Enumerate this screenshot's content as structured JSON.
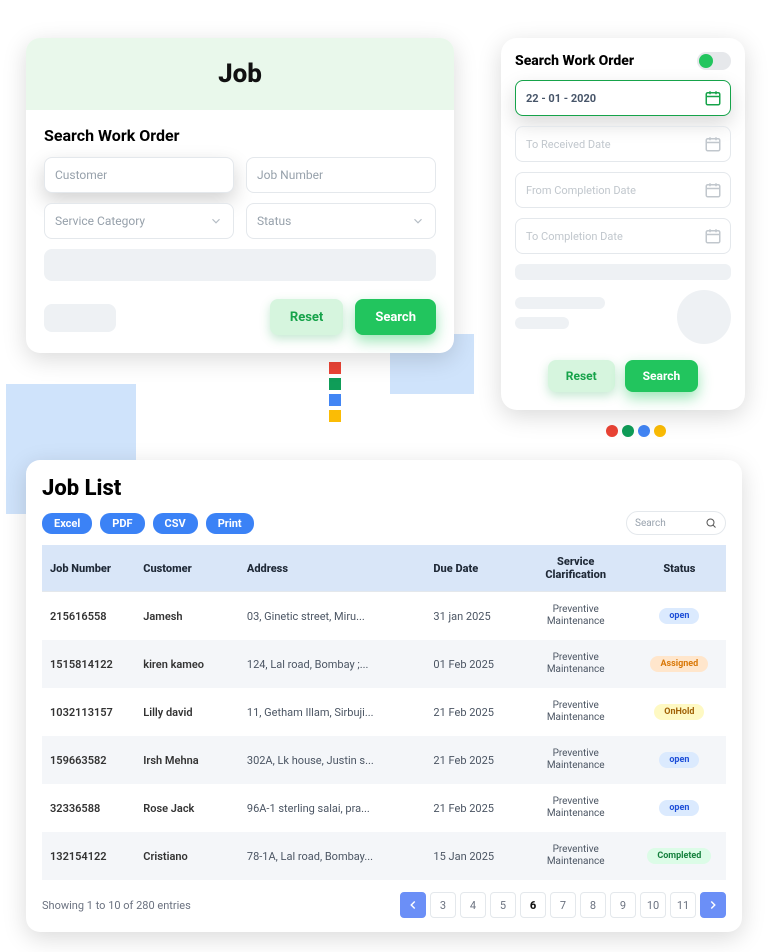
{
  "job_card": {
    "title": "Job",
    "subtitle": "Search Work Order",
    "fields": {
      "customer": "Customer",
      "job_number": "Job Number",
      "service_category": "Service Category",
      "status": "Status"
    },
    "reset": "Reset",
    "search": "Search"
  },
  "swo_card": {
    "title": "Search Work Order",
    "date_value": "22 - 01 - 2020",
    "f1": "To Received Date",
    "f2": "From Completion Date",
    "f3": "To Completion Date",
    "reset": "Reset",
    "search": "Search"
  },
  "job_list": {
    "title": "Job List",
    "exports": [
      "Excel",
      "PDF",
      "CSV",
      "Print"
    ],
    "search_placeholder": "Search",
    "columns": [
      "Job Number",
      "Customer",
      "Address",
      "Due Date",
      "Service Clarification",
      "Status"
    ],
    "rows": [
      {
        "job": "215616558",
        "customer": "Jamesh",
        "address": "03, Ginetic street, Miru...",
        "due": "31 jan 2025",
        "service": "Preventive Maintenance",
        "status": "open",
        "cls": "b-open"
      },
      {
        "job": "1515814122",
        "customer": "kiren kameo",
        "address": "124, Lal road, Bombay ;...",
        "due": "01 Feb 2025",
        "service": "Preventive Maintenance",
        "status": "Assigned",
        "cls": "b-assigned"
      },
      {
        "job": "1032113157",
        "customer": "Lilly david",
        "address": "11, Getham Illam, Sirbuji...",
        "due": "21 Feb 2025",
        "service": "Preventive Maintenance",
        "status": "OnHold",
        "cls": "b-onhold"
      },
      {
        "job": "159663582",
        "customer": "Irsh Mehna",
        "address": "302A, Lk house, Justin s...",
        "due": "21 Feb 2025",
        "service": "Preventive Maintenance",
        "status": "open",
        "cls": "b-open"
      },
      {
        "job": "32336588",
        "customer": "Rose Jack",
        "address": "96A-1 sterling salai, pra...",
        "due": "21 Feb 2025",
        "service": "Preventive Maintenance",
        "status": "open",
        "cls": "b-open"
      },
      {
        "job": "132154122",
        "customer": "Cristiano",
        "address": "78-1A, Lal road, Bombay...",
        "due": "15 Jan 2025",
        "service": "Preventive Maintenance",
        "status": "Completed",
        "cls": "b-completed"
      }
    ],
    "footer": "Showing 1 to 10 of 280 entries",
    "pages": [
      "3",
      "4",
      "5",
      "6",
      "7",
      "8",
      "9",
      "10",
      "11"
    ],
    "active_page": "6"
  }
}
